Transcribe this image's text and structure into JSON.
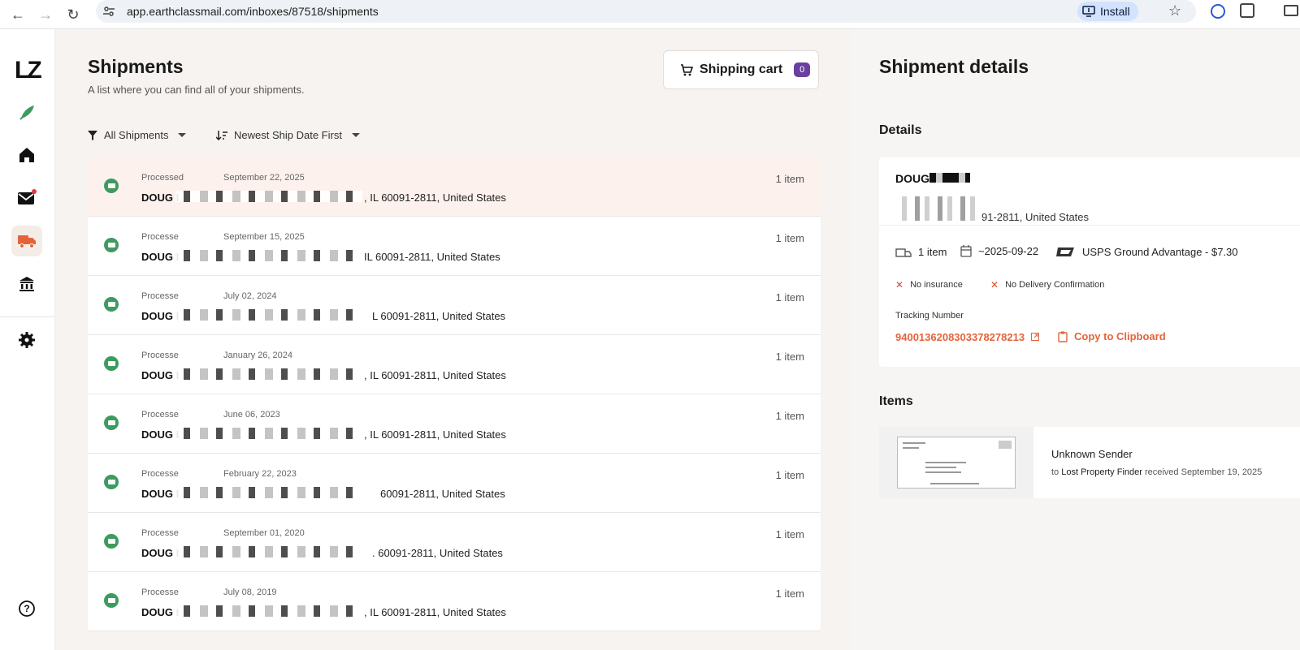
{
  "browser": {
    "url": "app.earthclassmail.com/inboxes/87518/shipments",
    "install_label": "Install"
  },
  "rail": {
    "logo": "LZ"
  },
  "list": {
    "title": "Shipments",
    "subtitle": "A list where you can find all of your shipments.",
    "cart_label": "Shipping cart",
    "cart_count": "0",
    "filter_label": "All Shipments",
    "sort_label": "Newest Ship Date First",
    "rows": [
      {
        "status": "Processed",
        "date": "September 22, 2025",
        "name": "DOUG I",
        "address": ", IL 60091-2811, United States",
        "count": "1 item"
      },
      {
        "status": "Processe",
        "date": "September 15, 2025",
        "name": "DOUG I",
        "address": "IL 60091-2811, United States",
        "count": "1 item"
      },
      {
        "status": "Processe",
        "date": "July 02, 2024",
        "name": "DOUG I",
        "address": "L 60091-2811, United States",
        "count": "1 item"
      },
      {
        "status": "Processe",
        "date": "January 26, 2024",
        "name": "DOUG I",
        "address": ", IL 60091-2811, United States",
        "count": "1 item"
      },
      {
        "status": "Processe",
        "date": "June 06, 2023",
        "name": "DOUG I",
        "address": ", IL 60091-2811, United States",
        "count": "1 item"
      },
      {
        "status": "Processe",
        "date": "February 22, 2023",
        "name": "DOUG I",
        "address": "60091-2811, United States",
        "count": "1 item"
      },
      {
        "status": "Processe",
        "date": "September 01, 2020",
        "name": "DOUG I",
        "address": ". 60091-2811, United States",
        "count": "1 item"
      },
      {
        "status": "Processe",
        "date": "July 08, 2019",
        "name": "DOUG I",
        "address": ", IL 60091-2811, United States",
        "count": "1 item"
      }
    ]
  },
  "details": {
    "title": "Shipment details",
    "section_details": "Details",
    "recipient_name": "DOUG",
    "address_tail": "91-2811, United States",
    "items_count": "1 item",
    "ship_date": "~2025-09-22",
    "service": "USPS Ground Advantage - $7.30",
    "insurance": "No insurance",
    "delivery_confirmation": "No Delivery Confirmation",
    "tracking_label": "Tracking Number",
    "tracking_number": "9400136208303378278213",
    "copy_label": "Copy to Clipboard",
    "section_items": "Items",
    "item": {
      "sender": "Unknown Sender",
      "to_prefix": "to",
      "recipient": "Lost Property Finder",
      "received": "received September 19, 2025"
    }
  },
  "colors": {
    "accent": "#e3643b",
    "badge": "#6b3fa0",
    "status_green": "#3e9b5f"
  }
}
